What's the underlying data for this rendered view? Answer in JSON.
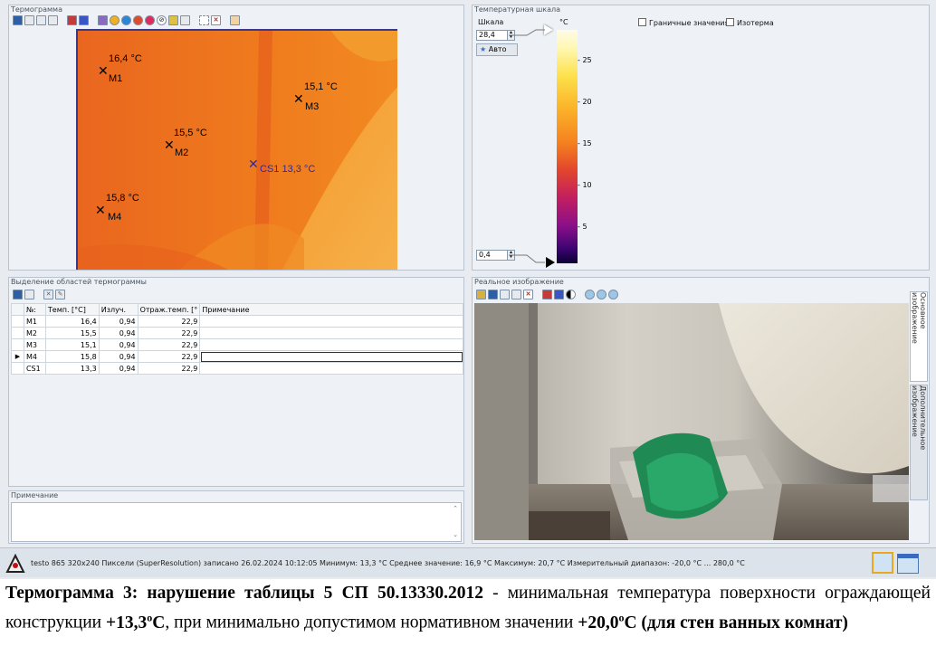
{
  "thermogram": {
    "title": "Термограмма",
    "markers": [
      {
        "name": "M1",
        "temp": "16,4 °C"
      },
      {
        "name": "M2",
        "temp": "15,5 °C"
      },
      {
        "name": "M3",
        "temp": "15,1 °C"
      },
      {
        "name": "M4",
        "temp": "15,8 °C"
      },
      {
        "name": "CS1",
        "temp": "13,3 °C"
      }
    ]
  },
  "scale": {
    "title": "Температурная шкала",
    "scale_label": "Шкала",
    "max_value": "28,4",
    "min_value": "0,4",
    "auto_label": "Авто",
    "unit": "°C",
    "ticks": [
      "25",
      "20",
      "15",
      "10",
      "5"
    ],
    "limit_values_label": "Граничные значения",
    "isotherm_label": "Изотерма"
  },
  "regions": {
    "title": "Выделение областей термограммы",
    "columns": [
      "№:",
      "Темп. [°C]",
      "Излуч.",
      "Отраж.темп. [°",
      "Примечание"
    ],
    "rows": [
      {
        "id": "M1",
        "temp": "16,4",
        "emis": "0,94",
        "refl": "22,9",
        "note": ""
      },
      {
        "id": "M2",
        "temp": "15,5",
        "emis": "0,94",
        "refl": "22,9",
        "note": ""
      },
      {
        "id": "M3",
        "temp": "15,1",
        "emis": "0,94",
        "refl": "22,9",
        "note": ""
      },
      {
        "id": "M4",
        "temp": "15,8",
        "emis": "0,94",
        "refl": "22,9",
        "note": ""
      },
      {
        "id": "CS1",
        "temp": "13,3",
        "emis": "0,94",
        "refl": "22,9",
        "note": ""
      }
    ]
  },
  "note": {
    "title": "Примечание"
  },
  "real_image": {
    "title": "Реальное изображение",
    "tab_main": "Основное изображение",
    "tab_extra": "Дополнительное изображение"
  },
  "status": {
    "text": "testo 865 320x240 Пиксели (SuperResolution) записано 26.02.2024 10:12:05 Минимум: 13,3 °C Среднее значение: 16,9 °C Максимум: 20,7 °C Измерительный диапазон: -20,0 °C ... 280,0 °C"
  },
  "caption": {
    "part1": "Термограмма 3: нарушение таблицы 5 СП 50.13330.2012",
    "part2": " - минимальная температура поверхности ограждающей конструкции ",
    "part3": "+13,3",
    "part3_sup": "о",
    "part3_unit": "С",
    "part4": ", при минимально допустимом нормативном значении ",
    "part5": "+20,0",
    "part5_sup": "о",
    "part5_unit": "С (для стен ванных комнат)"
  },
  "colors": {
    "thermo_main": "#f07a1a",
    "thermo_dark": "#e8621c",
    "thermo_light": "#f4a040",
    "cs1": "#2a2aa8"
  }
}
